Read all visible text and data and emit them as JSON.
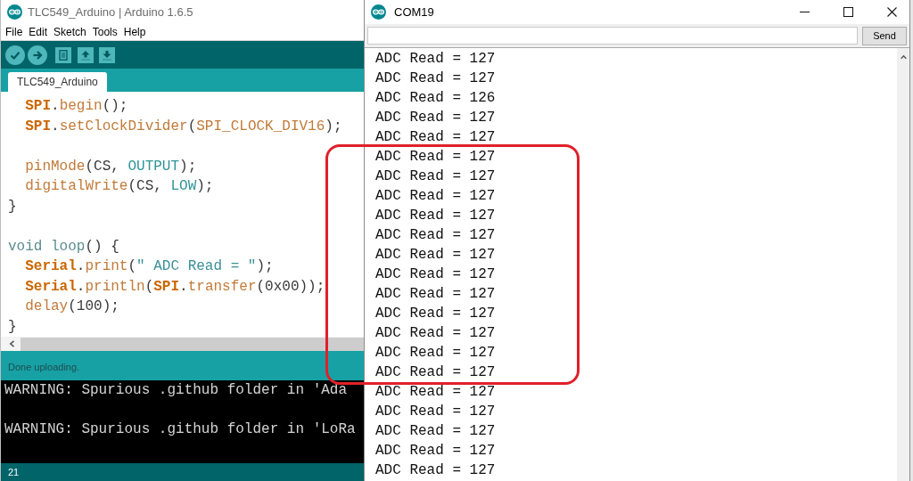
{
  "ide_window": {
    "title": "TLC549_Arduino | Arduino 1.6.5",
    "menu": [
      "File",
      "Edit",
      "Sketch",
      "Tools",
      "Help"
    ],
    "tabs": [
      {
        "label": "TLC549_Arduino",
        "selected": true
      }
    ],
    "code_lines": [
      {
        "kind": "code",
        "indented": true,
        "tokens": [
          {
            "text": "SPI",
            "kind": "keyword"
          },
          {
            "text": ".",
            "kind": "plain"
          },
          {
            "text": "begin",
            "kind": "function"
          },
          {
            "text": "();",
            "kind": "plain"
          }
        ]
      },
      {
        "kind": "code",
        "indented": true,
        "tokens": [
          {
            "text": "SPI",
            "kind": "keyword"
          },
          {
            "text": ".",
            "kind": "plain"
          },
          {
            "text": "setClockDivider",
            "kind": "function"
          },
          {
            "text": "(",
            "kind": "plain"
          },
          {
            "text": "SPI_CLOCK_DIV16",
            "kind": "function"
          },
          {
            "text": ");",
            "kind": "plain"
          }
        ]
      },
      {
        "kind": "blank"
      },
      {
        "kind": "code",
        "indented": true,
        "tokens": [
          {
            "text": "pinMode",
            "kind": "function"
          },
          {
            "text": "(CS, ",
            "kind": "plain"
          },
          {
            "text": "OUTPUT",
            "kind": "constant"
          },
          {
            "text": ");",
            "kind": "plain"
          }
        ]
      },
      {
        "kind": "code",
        "indented": true,
        "tokens": [
          {
            "text": "digitalWrite",
            "kind": "function"
          },
          {
            "text": "(CS, ",
            "kind": "plain"
          },
          {
            "text": "LOW",
            "kind": "constant"
          },
          {
            "text": ");",
            "kind": "plain"
          }
        ]
      },
      {
        "kind": "code",
        "indented": false,
        "tokens": [
          {
            "text": "}",
            "kind": "plain"
          }
        ]
      },
      {
        "kind": "blank"
      },
      {
        "kind": "code",
        "indented": false,
        "tokens": [
          {
            "text": "void loop",
            "kind": "type"
          },
          {
            "text": "() {",
            "kind": "plain"
          }
        ]
      },
      {
        "kind": "code",
        "indented": true,
        "tokens": [
          {
            "text": "Serial",
            "kind": "keyword"
          },
          {
            "text": ".",
            "kind": "plain"
          },
          {
            "text": "print",
            "kind": "function"
          },
          {
            "text": "(",
            "kind": "plain"
          },
          {
            "text": "\" ADC Read = \"",
            "kind": "string"
          },
          {
            "text": ");",
            "kind": "plain"
          }
        ]
      },
      {
        "kind": "code",
        "indented": true,
        "tokens": [
          {
            "text": "Serial",
            "kind": "keyword"
          },
          {
            "text": ".",
            "kind": "plain"
          },
          {
            "text": "println",
            "kind": "function"
          },
          {
            "text": "(",
            "kind": "plain"
          },
          {
            "text": "SPI",
            "kind": "keyword"
          },
          {
            "text": ".",
            "kind": "plain"
          },
          {
            "text": "transfer",
            "kind": "function"
          },
          {
            "text": "(0x00));",
            "kind": "plain"
          }
        ]
      },
      {
        "kind": "code",
        "indented": true,
        "tokens": [
          {
            "text": "delay",
            "kind": "function"
          },
          {
            "text": "(100);",
            "kind": "plain"
          }
        ]
      },
      {
        "kind": "code",
        "indented": false,
        "tokens": [
          {
            "text": "}",
            "kind": "plain"
          }
        ]
      }
    ],
    "status_message": "Done uploading.",
    "console_lines": [
      {
        "kind": "text",
        "text": "WARNING: Spurious .github folder in 'Ada"
      },
      {
        "kind": "blank"
      },
      {
        "kind": "text",
        "text": "WARNING: Spurious .github folder in 'LoRa"
      }
    ],
    "line_number": "21"
  },
  "serial_monitor": {
    "title": "COM19",
    "send_button": "Send",
    "segments": [
      {
        "highlighted": false,
        "lines": [
          "ADC Read = 127",
          "ADC Read = 127",
          "ADC Read = 126",
          "ADC Read = 127",
          "ADC Read = 127"
        ]
      },
      {
        "highlighted": true,
        "lines": [
          "ADC Read = 127",
          "ADC Read = 127",
          "ADC Read = 127",
          "ADC Read = 127",
          "ADC Read = 127",
          "ADC Read = 127",
          "ADC Read = 127",
          "ADC Read = 127",
          "ADC Read = 127",
          "ADC Read = 127",
          "ADC Read = 127",
          "ADC Read = 127"
        ]
      },
      {
        "highlighted": false,
        "lines": [
          "ADC Read = 127",
          "ADC Read = 127",
          "ADC Read = 127",
          "ADC Read = 127",
          "ADC Read = 127"
        ]
      }
    ]
  }
}
